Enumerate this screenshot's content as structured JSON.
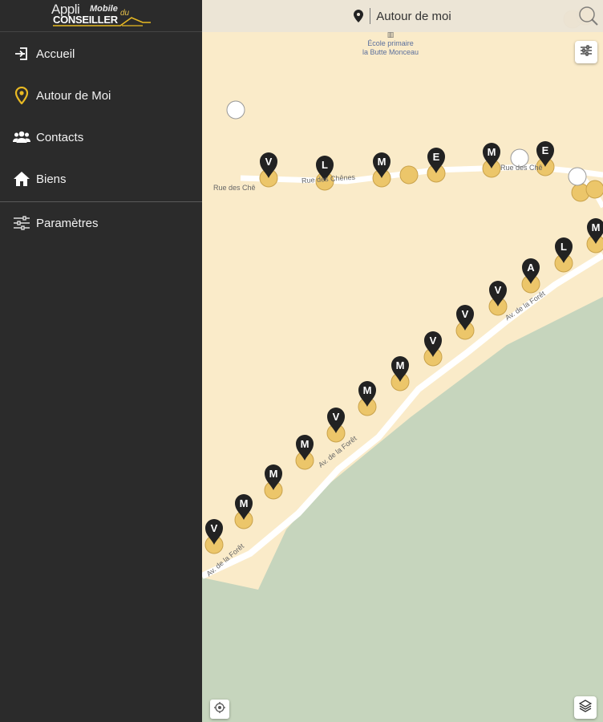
{
  "app": {
    "logo_appli": "Appli",
    "logo_mobile": "Mobile",
    "logo_du": "du",
    "logo_conseiller": "CONSEILLER"
  },
  "nav": {
    "items": [
      {
        "label": "Accueil",
        "icon": "login-icon"
      },
      {
        "label": "Autour de Moi",
        "icon": "location-pin-icon"
      },
      {
        "label": "Contacts",
        "icon": "contacts-icon"
      },
      {
        "label": "Biens",
        "icon": "home-icon"
      }
    ],
    "settings": {
      "label": "Paramètres",
      "icon": "sliders-icon"
    }
  },
  "header": {
    "title": "Autour de moi"
  },
  "map": {
    "poi": {
      "line1": "École primaire",
      "line2": "la Butte Monceau"
    },
    "streets": {
      "rue_des_chenes_left": "Rue des Chê",
      "rue_des_chenes_mid": "Rue des Chênes",
      "rue_des_chenes_right": "Rue des Chê",
      "av_foret_1": "Av. de la Forêt",
      "av_foret_2": "Av. de la Forêt",
      "av_foret_3": "Av. de la Forêt"
    },
    "markers_top": [
      "V",
      "L",
      "M",
      "E",
      "M",
      "E"
    ],
    "markers_diag": [
      "V",
      "M",
      "M",
      "M",
      "V",
      "M",
      "M",
      "V",
      "V",
      "V",
      "A",
      "L",
      "M"
    ]
  },
  "colors": {
    "sidebar_bg": "#2b2b2b",
    "map_residential": "#faebc9",
    "map_forest": "#c6d5bd",
    "marker_fill": "#222222",
    "dot_fill": "#ecc66a",
    "accent": "#e8b923"
  }
}
